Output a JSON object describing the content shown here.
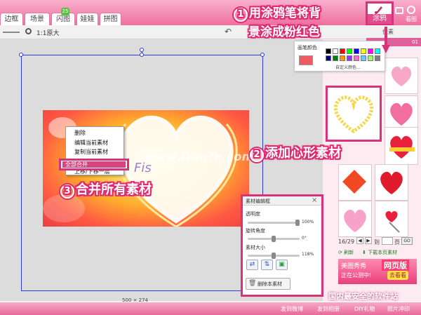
{
  "tabs": [
    "边框",
    "场景",
    "闪图",
    "娃娃",
    "拼图"
  ],
  "tab_badge": "25",
  "toolbar": {
    "zoom_label": "1:1原大",
    "right_label": "像素"
  },
  "canvas": {
    "size_readout": "500 × 274"
  },
  "context_menu": {
    "items": [
      "删除",
      "编辑当前素材",
      "复制当前素材",
      "全部合并",
      "上移/下移一层"
    ]
  },
  "merge_highlight": "全部合并",
  "photo_overlay_text": "Fis",
  "watermark": "www.DuoTe.com",
  "doodle_button": {
    "label": "涂鸦"
  },
  "top_right_icons": {
    "icon1": "camera-icon",
    "icon2": "view-icon",
    "label2": "看图"
  },
  "color_popup": {
    "title": "画笔颜色",
    "custom_label": "自定义颜色...",
    "current_color": "#f05a63",
    "swatches": [
      "#000000",
      "#ffffff",
      "#ff0000",
      "#00ff00",
      "#0000ff",
      "#ffff00",
      "#ff00ff",
      "#00ffff",
      "#000080",
      "#008000",
      "#ff9900",
      "#9933ff",
      "#ff66cc",
      "#66ccff",
      "#99ff66",
      "#808080"
    ]
  },
  "right_panel": {
    "tab_hint": "01",
    "page": "16/29",
    "page_goto": "到",
    "page_unit": "页",
    "go_label": "GO",
    "refresh_label": "刷新",
    "download_label": "下载本页素材",
    "promo_text_1": "美图秀秀",
    "promo_text_2": "网页版",
    "promo_text_3": "正在公测中!",
    "promo_button": "去看看"
  },
  "editor": {
    "title": "素材编辑框",
    "opacity_label": "透明度",
    "opacity_value": "100%",
    "opacity": 1.0,
    "rotate_label": "旋转角度",
    "rotate_value": "0°",
    "rotate": 0.5,
    "size_label": "素材大小",
    "size_value": "118%",
    "size": 0.5,
    "delete_label": "删除本素材"
  },
  "bottom_bar": {
    "site_slogan": "国内最安全的软件站",
    "items": [
      "发到微博",
      "发到相册",
      "DIY礼物",
      "照片冲印"
    ]
  },
  "annotations": {
    "step1_num": "1",
    "step1_line1": "用涂鸦笔将背",
    "step1_line2": "景涂成粉红色",
    "step2_num": "2",
    "step2_text": "添加心形素材",
    "step3_num": "3",
    "step3_text": "合并所有素材"
  },
  "colors": {
    "accent": "#e0296f",
    "annotation_box": "#d6337a",
    "selection_guide": "#2a3bd0"
  }
}
